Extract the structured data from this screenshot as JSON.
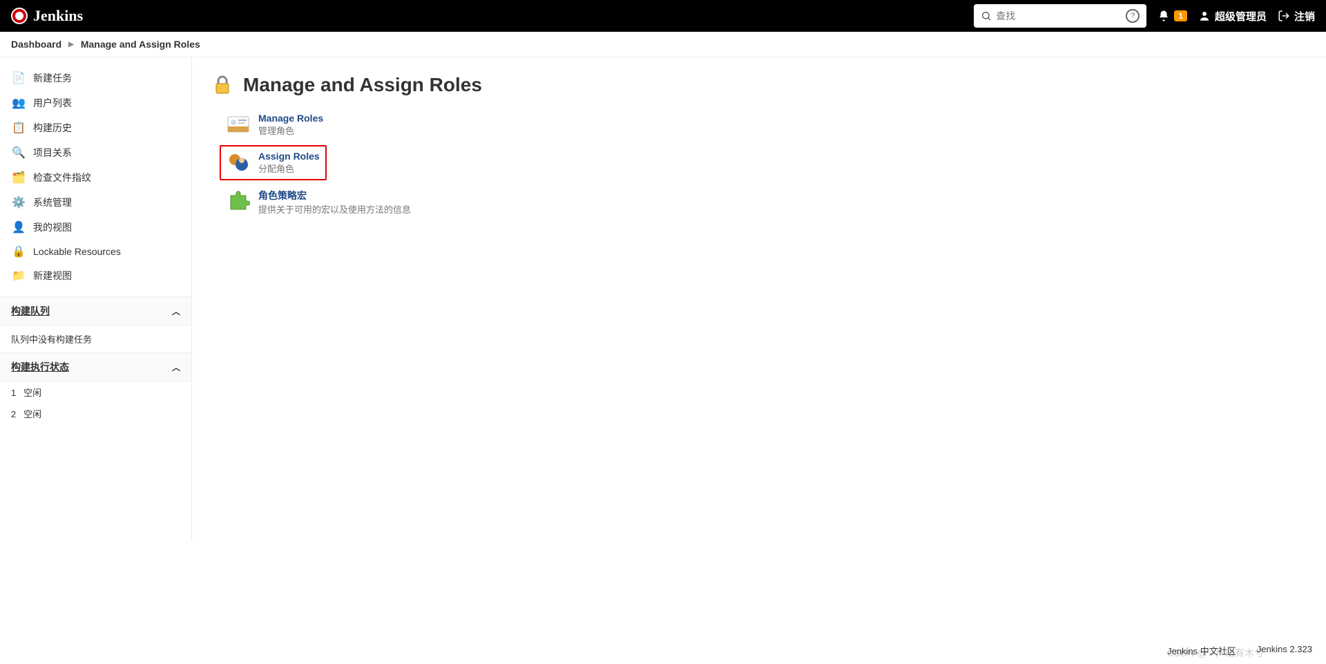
{
  "header": {
    "brand": "Jenkins",
    "search_placeholder": "查找",
    "notify_count": "1",
    "username": "超级管理员",
    "logout": "注销"
  },
  "breadcrumb": {
    "items": [
      "Dashboard",
      "Manage and Assign Roles"
    ]
  },
  "sidebar": {
    "items": [
      {
        "label": "新建任务",
        "icon": "📄"
      },
      {
        "label": "用户列表",
        "icon": "👥"
      },
      {
        "label": "构建历史",
        "icon": "📋"
      },
      {
        "label": "项目关系",
        "icon": "🔍"
      },
      {
        "label": "检查文件指纹",
        "icon": "🗂️"
      },
      {
        "label": "系统管理",
        "icon": "⚙️"
      },
      {
        "label": "我的视图",
        "icon": "👤"
      },
      {
        "label": "Lockable Resources",
        "icon": "🔒"
      },
      {
        "label": "新建视图",
        "icon": "📁"
      }
    ],
    "queue": {
      "title": "构建队列",
      "empty_text": "队列中没有构建任务"
    },
    "executor": {
      "title": "构建执行状态",
      "rows": [
        {
          "num": "1",
          "state": "空闲"
        },
        {
          "num": "2",
          "state": "空闲"
        }
      ]
    }
  },
  "main": {
    "title": "Manage and Assign Roles",
    "items": [
      {
        "title": "Manage Roles",
        "desc": "管理角色",
        "highlight": false,
        "icon": "id-card"
      },
      {
        "title": "Assign Roles",
        "desc": "分配角色",
        "highlight": true,
        "icon": "users"
      },
      {
        "title": "角色策略宏",
        "desc": "提供关于可用的宏以及使用方法的信息",
        "highlight": false,
        "icon": "puzzle"
      }
    ]
  },
  "footer": {
    "left": "Jenkins 中文社区",
    "right": "Jenkins 2.323"
  },
  "watermark": "CSDN @ › 广山有木兮"
}
